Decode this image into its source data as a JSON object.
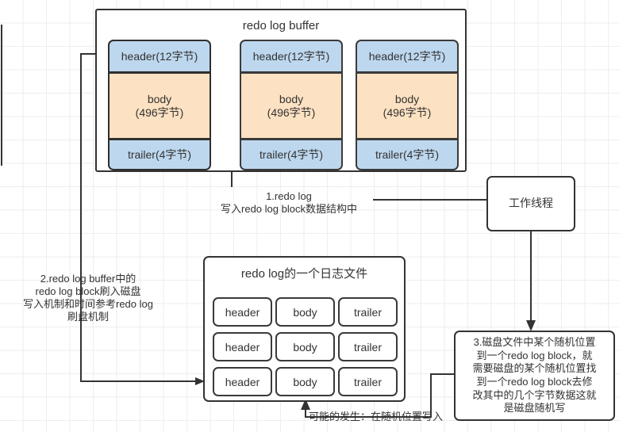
{
  "diagram": {
    "buffer": {
      "title": "redo log buffer",
      "blocks": [
        {
          "header": "header(12字节)",
          "body": "body\n(496字节)",
          "trailer": "trailer(4字节)"
        },
        {
          "header": "header(12字节)",
          "body": "body\n(496字节)",
          "trailer": "trailer(4字节)"
        },
        {
          "header": "header(12字节)",
          "body": "body\n(496字节)",
          "trailer": "trailer(4字节)"
        }
      ]
    },
    "worker": {
      "label": "工作线程"
    },
    "logfile": {
      "title": "redo log的一个日志文件",
      "columns": [
        "header",
        "body",
        "trailer"
      ],
      "rows": [
        [
          "header",
          "body",
          "trailer"
        ],
        [
          "header",
          "body",
          "trailer"
        ],
        [
          "header",
          "body",
          "trailer"
        ]
      ]
    },
    "notes": {
      "step1": "1.redo log\n写入redo log block数据结构中",
      "step2": "2.redo log buffer中的\nredo log block刷入磁盘\n写入机制和时间参考redo log\n刷盘机制",
      "step3": "3.磁盘文件中某个随机位置\n到一个redo log block，就\n需要磁盘的某个随机位置找\n到一个redo log block去修\n改其中的几个字节数据这就\n是磁盘随机写",
      "step4": "可能的发生：在随机位置写入"
    },
    "colors": {
      "header_fill": "#bdd7ee",
      "body_fill": "#fce1c2",
      "trailer_fill": "#bdd7ee",
      "stroke": "#333333",
      "grid": "#eeeeee",
      "background": "#ffffff"
    }
  }
}
